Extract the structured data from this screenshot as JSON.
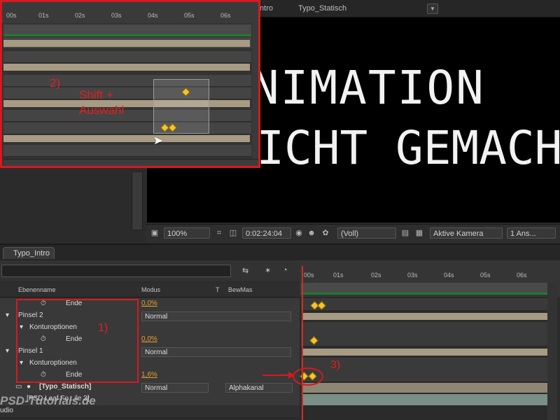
{
  "viewer": {
    "tabs": [
      "Typo_Intro",
      "Typo_Statisch"
    ],
    "line1": "ANIMATION",
    "line2": "LEICHT GEMACHT",
    "zoom": "100%",
    "timecode": "0:02:24:04",
    "resolution": "(Voll)",
    "camera": "Aktive Kamera",
    "views": "1 Ans..."
  },
  "inset": {
    "ruler": [
      "00s",
      "01s",
      "02s",
      "03s",
      "04s",
      "05s",
      "06s"
    ],
    "step_label": "2)",
    "shift_label_line1": "Shift +",
    "shift_label_line2": "Auswahl"
  },
  "timeline": {
    "tab": "Typo_Intro",
    "columns": {
      "name": "Ebenenname",
      "mode": "Modus",
      "t": "T",
      "trkmat": "BewMas"
    },
    "ruler": [
      "00s",
      "01s",
      "02s",
      "03s",
      "04s",
      "05s",
      "06s"
    ],
    "rows": {
      "ende1": {
        "label": "Ende",
        "value": "0,0%"
      },
      "pinsel2": {
        "label": "Pinsel 2",
        "mode": "Normal"
      },
      "kontur2": {
        "label": "Konturoptionen"
      },
      "ende2": {
        "label": "Ende",
        "value": "0,0%"
      },
      "pinsel1": {
        "label": "Pinsel 1",
        "mode": "Normal"
      },
      "kontur1": {
        "label": "Konturoptionen"
      },
      "ende3": {
        "label": "Ende",
        "value": "1,6%"
      },
      "typo": {
        "label": "[Typo_Statisch]",
        "mode": "Normal",
        "trkmat": "Alphakanal"
      },
      "leaf": {
        "label": "[PSD Leaf Fo...ile 3]"
      }
    },
    "step1_label": "1)",
    "step3_label": "3)",
    "bottom_left": "udio"
  },
  "watermark": "PSD-Tutorials.de"
}
